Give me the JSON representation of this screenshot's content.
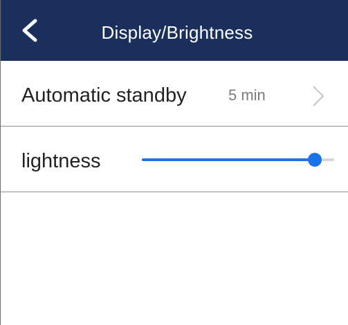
{
  "header": {
    "title": "Display/Brightness",
    "back_icon": "chevron-left-icon",
    "background_color": "#1b2f5c"
  },
  "settings": {
    "standby": {
      "label": "Automatic standby",
      "value": "5 min",
      "icon": "chevron-right-icon"
    },
    "lightness": {
      "label": "lightness",
      "level_fraction": 0.9,
      "accent_color": "#1a73e8"
    }
  }
}
